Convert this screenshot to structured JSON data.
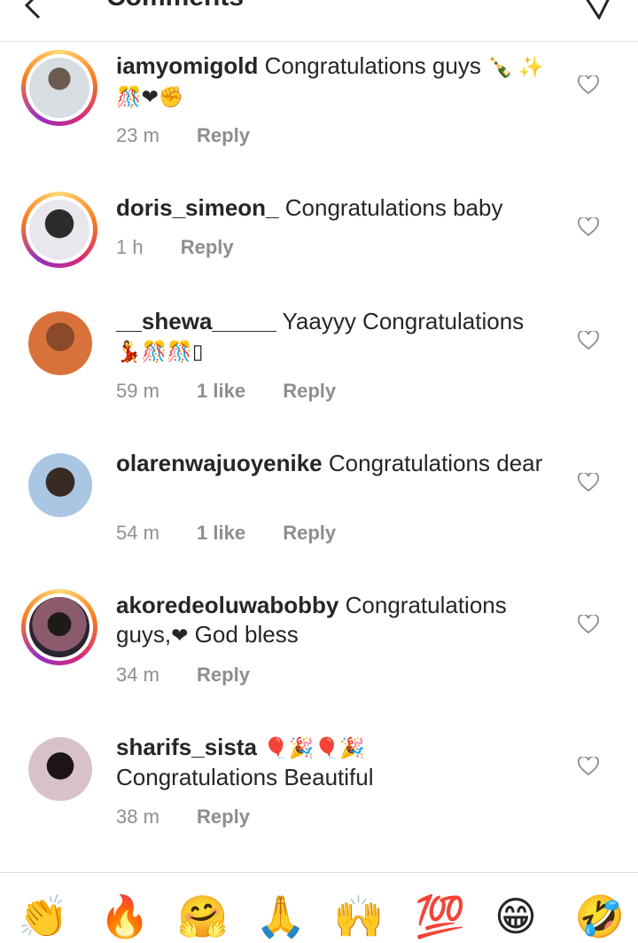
{
  "header": {
    "title": "Comments"
  },
  "comments": [
    {
      "username": "iamyomigold",
      "text": "Congratulations guys",
      "emojis": "🍾 ✨🎊❤✊",
      "time": "23 m",
      "likes": "",
      "reply": "Reply"
    },
    {
      "username": "doris_simeon_",
      "text": "Congratulations baby",
      "emojis": "",
      "time": "1 h",
      "likes": "",
      "reply": "Reply"
    },
    {
      "username": "__shewa_____",
      "text": "Yaayyy Congratulations",
      "emojis": "💃🎊🎊▯",
      "time": "59 m",
      "likes": "1 like",
      "reply": "Reply"
    },
    {
      "username": "olarenwajuoyenike",
      "text": "Congratulations dear",
      "emojis": "",
      "time": "54 m",
      "likes": "1 like",
      "reply": "Reply"
    },
    {
      "username": "akoredeoluwabobby",
      "text": "Congratulations guys,",
      "emojis": "❤",
      "text2": "God bless",
      "time": "34 m",
      "likes": "",
      "reply": "Reply"
    },
    {
      "username": "sharifs_sista",
      "text": "Congratulations Beautiful",
      "emojis": "🎈🎉🎈🎉",
      "time": "38 m",
      "likes": "",
      "reply": "Reply"
    }
  ],
  "emoji_bar": [
    "👏",
    "🔥",
    "🤗",
    "🙏",
    "🙌",
    "💯",
    "😁",
    "🤣"
  ]
}
